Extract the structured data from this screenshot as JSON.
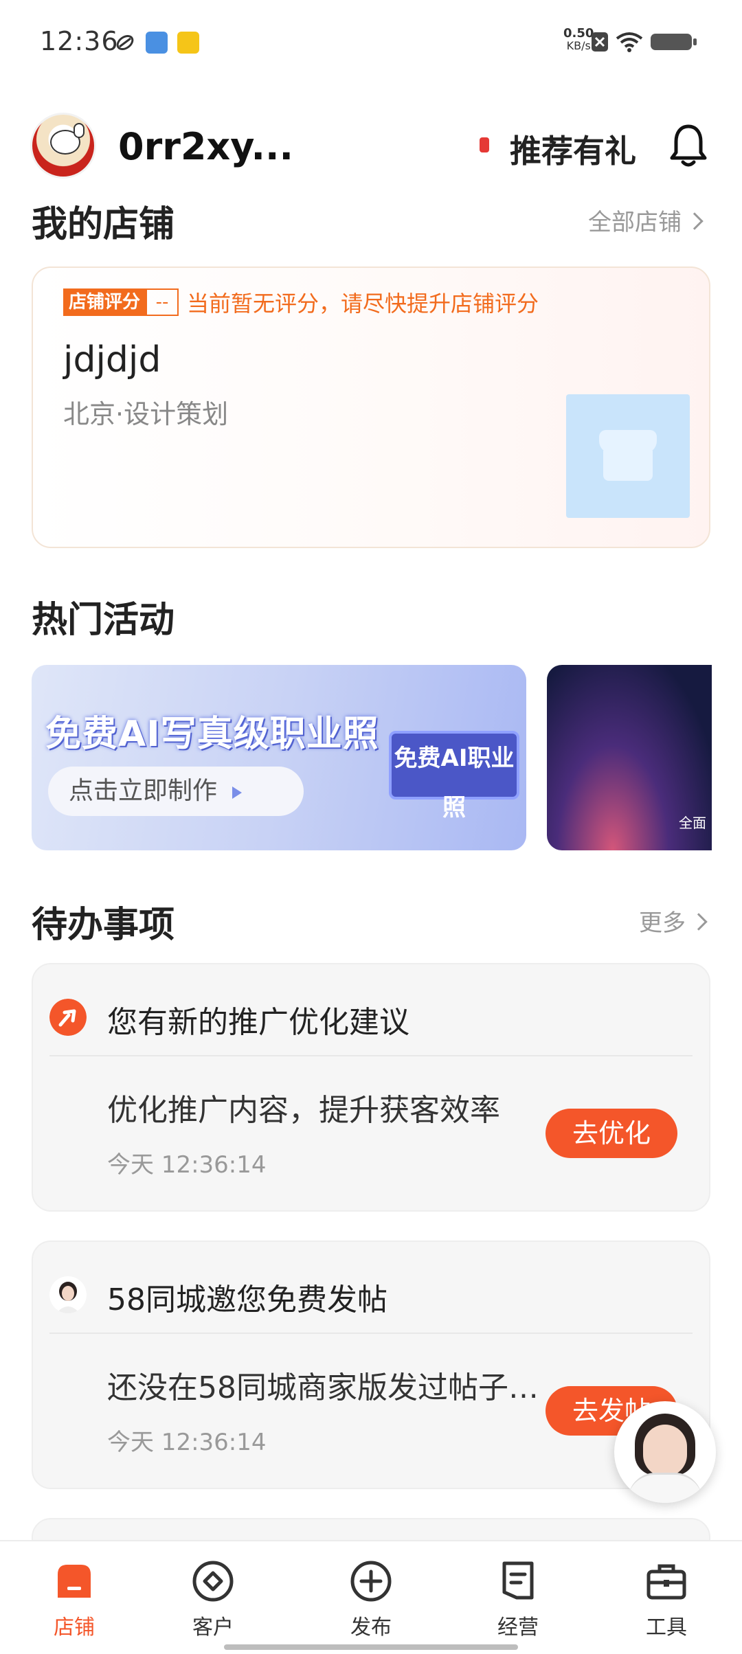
{
  "status_bar": {
    "time": "12:36",
    "net_speed": "0.50",
    "net_unit": "KB/s"
  },
  "header": {
    "username": "0rr2xy...",
    "recommend_label": "推荐有礼"
  },
  "my_store": {
    "title": "我的店铺",
    "all_link": "全部店铺",
    "rating_tag": "店铺评分",
    "rating_value": "--",
    "rating_hint": "当前暂无评分，请尽快提升店铺评分",
    "store_name": "jdjdjd",
    "location": "北京·设计策划"
  },
  "activities": {
    "title": "热门活动",
    "banner_text": "免费AI写真级职业照",
    "banner_button": "点击立即制作",
    "banner_sign": "免费AI职业照",
    "banner2_caption": "全面"
  },
  "todo": {
    "title": "待办事项",
    "more_link": "更多",
    "items": [
      {
        "header": "您有新的推广优化建议",
        "desc": "优化推广内容，提升获客效率",
        "time": "今天 12:36:14",
        "button": "去优化"
      },
      {
        "header": "58同城邀您免费发帖",
        "desc": "还没在58同城商家版发过帖子…",
        "time": "今天 12:36:14",
        "button": "去发帖"
      }
    ]
  },
  "tabbar": {
    "tabs": [
      {
        "label": "店铺",
        "icon": "store-icon"
      },
      {
        "label": "客户",
        "icon": "customer-icon"
      },
      {
        "label": "发布",
        "icon": "publish-icon"
      },
      {
        "label": "经营",
        "icon": "operation-icon"
      },
      {
        "label": "工具",
        "icon": "tools-icon"
      }
    ],
    "active_color": "#f4562a"
  }
}
